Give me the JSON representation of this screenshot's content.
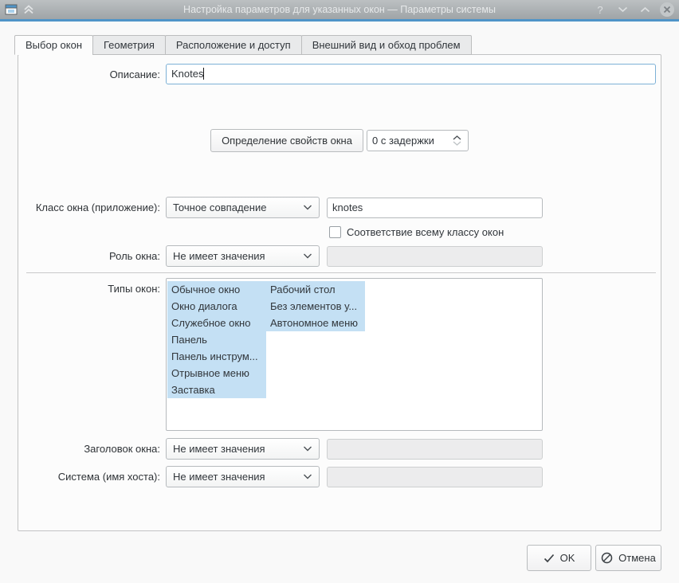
{
  "titlebar": {
    "title": "Настройка параметров для указанных окон — Параметры системы",
    "help_glyph": "?"
  },
  "tabs": [
    {
      "label": "Выбор окон",
      "active": true
    },
    {
      "label": "Геометрия",
      "active": false
    },
    {
      "label": "Расположение и доступ",
      "active": false
    },
    {
      "label": "Внешний вид и обход проблем",
      "active": false
    }
  ],
  "form": {
    "description": {
      "label": "Описание:",
      "value": "Knotes"
    },
    "detect": {
      "button_label": "Определение свойств окна",
      "delay_value": "0 с задержки"
    },
    "window_class": {
      "label": "Класс окна (приложение):",
      "match_mode": "Точное совпадение",
      "value": "knotes"
    },
    "whole_class_checkbox": {
      "label": "Соответствие всему классу окон",
      "checked": false
    },
    "role": {
      "label": "Роль окна:",
      "match_mode": "Не имеет значения",
      "value": ""
    },
    "types": {
      "label": "Типы окон:",
      "col1": [
        "Обычное окно",
        "Окно диалога",
        "Служебное окно",
        "Панель",
        "Панель инструм...",
        "Отрывное меню",
        "Заставка"
      ],
      "col2": [
        "Рабочий стол",
        "Без элементов у...",
        "Автономное меню"
      ]
    },
    "window_title": {
      "label": "Заголовок окна:",
      "match_mode": "Не имеет значения",
      "value": ""
    },
    "machine": {
      "label": "Система (имя хоста):",
      "match_mode": "Не имеет значения",
      "value": ""
    }
  },
  "footer": {
    "ok_label": "OK",
    "cancel_label": "Отмена"
  },
  "colors": {
    "accent_line": "#4f94c8",
    "selection_highlight": "#c4e0f4",
    "titlebar_top": "#bcc0c2",
    "titlebar_bottom": "#9fa4a7",
    "panel_bg": "#fcfcfc",
    "focused_border": "#7db1d6"
  }
}
